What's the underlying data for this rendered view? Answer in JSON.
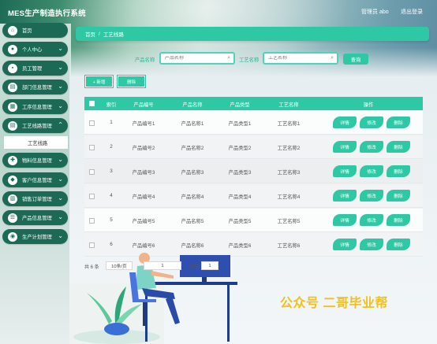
{
  "header": {
    "title": "MES生产制造执行系统",
    "admin": "管理员 abo",
    "logout": "退出登录"
  },
  "sidebar": {
    "items": [
      {
        "label": "首页",
        "icon": "home-icon"
      },
      {
        "label": "个人中心",
        "icon": "user-icon"
      },
      {
        "label": "员工管理",
        "icon": "staff-icon"
      },
      {
        "label": "部门信息管理",
        "icon": "dept-icon"
      },
      {
        "label": "工序信息管理",
        "icon": "process-icon"
      },
      {
        "label": "工艺线路管理",
        "icon": "route-icon"
      },
      {
        "label": "物料信息管理",
        "icon": "material-icon"
      },
      {
        "label": "客户信息管理",
        "icon": "customer-icon"
      },
      {
        "label": "销售订单管理",
        "icon": "order-icon"
      },
      {
        "label": "产品信息管理",
        "icon": "product-icon"
      },
      {
        "label": "生产计划管理",
        "icon": "plan-icon"
      }
    ],
    "active_sub": "工艺线路"
  },
  "breadcrumb": {
    "home": "首页",
    "sep": "/",
    "current": "工艺线路"
  },
  "search": {
    "product_label": "产品名称",
    "product_placeholder": "产品名称",
    "route_label": "工艺名称",
    "route_placeholder": "工艺名称",
    "query": "查询"
  },
  "actions": {
    "add": "+ 新增",
    "delete": "删除"
  },
  "table": {
    "headers": [
      "索引",
      "产品编号",
      "产品名称",
      "产品类型",
      "工艺名称",
      "操作"
    ],
    "rows": [
      [
        "1",
        "产品编号1",
        "产品名称1",
        "产品类型1",
        "工艺名称1"
      ],
      [
        "2",
        "产品编号2",
        "产品名称2",
        "产品类型2",
        "工艺名称2"
      ],
      [
        "3",
        "产品编号3",
        "产品名称3",
        "产品类型3",
        "工艺名称3"
      ],
      [
        "4",
        "产品编号4",
        "产品名称4",
        "产品类型4",
        "工艺名称4"
      ],
      [
        "5",
        "产品编号5",
        "产品名称5",
        "产品类型5",
        "工艺名称5"
      ],
      [
        "6",
        "产品编号6",
        "产品名称6",
        "产品类型6",
        "工艺名称6"
      ]
    ],
    "ops": [
      "详情",
      "修改",
      "删除"
    ]
  },
  "pagination": {
    "total": "共 6 条",
    "page_size": "10条/页",
    "current": "1",
    "goto_label": "前往",
    "goto_value": "1"
  },
  "watermark": "公众号 二哥毕业帮",
  "colors": {
    "accent": "#2ec9a4",
    "sidebar": "#1c6a55",
    "watermark": "#f0c020"
  }
}
